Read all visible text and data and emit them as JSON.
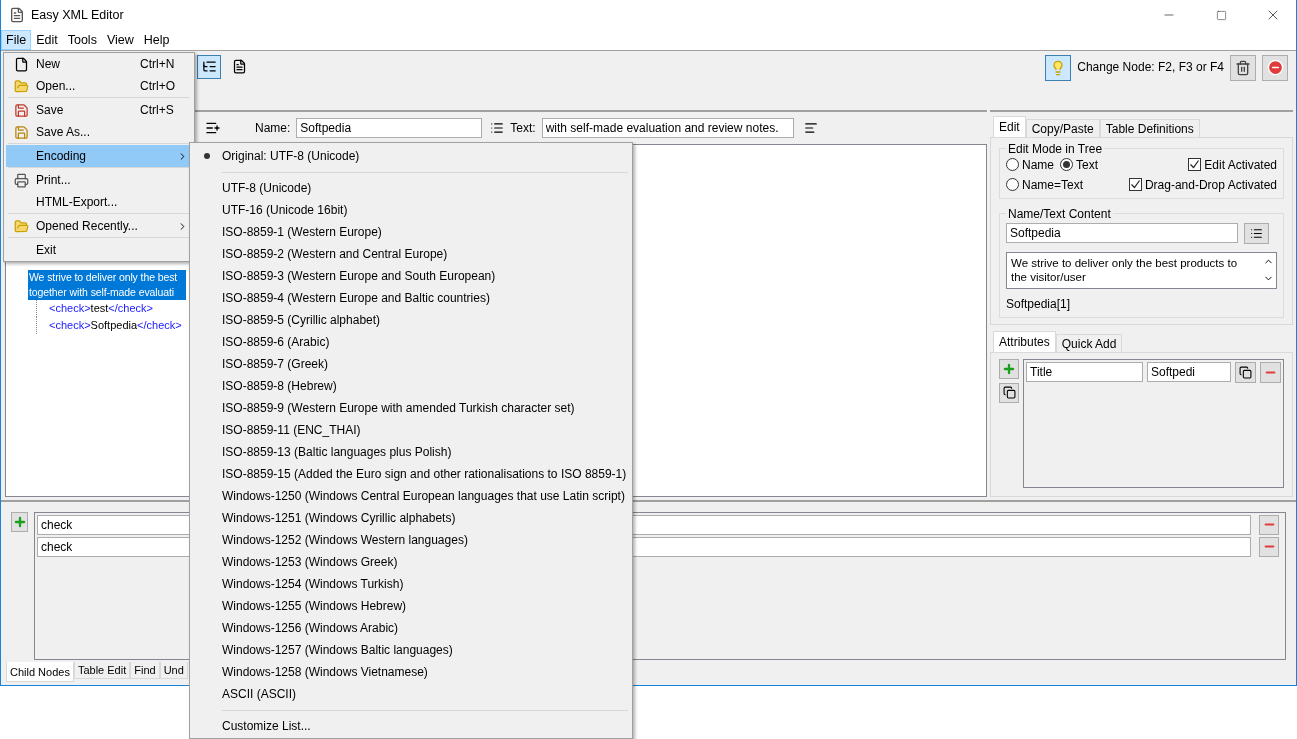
{
  "window": {
    "title": "Easy XML Editor"
  },
  "menu_bar": [
    {
      "label": "File",
      "selected": true
    },
    {
      "label": "Edit",
      "selected": false
    },
    {
      "label": "Tools",
      "selected": false
    },
    {
      "label": "View",
      "selected": false
    },
    {
      "label": "Help",
      "selected": false
    }
  ],
  "toolbar": {
    "view_buttons": [
      {
        "kind": "tree",
        "selected": true
      },
      {
        "kind": "text",
        "selected": false
      }
    ],
    "hint_button": {
      "selected": true
    },
    "hint": "Change Node: F2, F3 or F4"
  },
  "node_bar": {
    "name_label": "Name:",
    "name_value": "Softpedia",
    "text_label": "Text:",
    "text_value": "with self-made evaluation and review notes."
  },
  "tree": [
    {
      "kind": "text",
      "lines": [
        "We strive to deliver only the best",
        "together with self-made evaluati"
      ],
      "selected": true
    },
    {
      "kind": "element",
      "open_tag": "<check>",
      "text": "test",
      "close_tag": "</check>",
      "selected": false
    },
    {
      "kind": "element",
      "open_tag": "<check>",
      "text": "Softpedia",
      "close_tag": "</check>",
      "selected": false
    }
  ],
  "right_tabs": [
    {
      "label": "Edit",
      "selected": true
    },
    {
      "label": "Copy/Paste",
      "selected": false
    },
    {
      "label": "Table Definitions",
      "selected": false
    }
  ],
  "edit_mode": {
    "title": "Edit Mode in Tree",
    "radios": [
      {
        "label": "Name",
        "selected": false
      },
      {
        "label": "Text",
        "selected": true
      },
      {
        "label": "Name=Text",
        "selected": false
      }
    ],
    "checkboxes": [
      {
        "label": "Edit Activated",
        "checked": true
      },
      {
        "label": "Drag-and-Drop Activated",
        "checked": true
      }
    ]
  },
  "content": {
    "title": "Name/Text Content",
    "name_value": "Softpedia",
    "text_value": "We strive to deliver only the best products to the visitor/user",
    "path": "Softpedia[1]"
  },
  "attribute_tabs": [
    {
      "label": "Attributes",
      "selected": true
    },
    {
      "label": "Quick Add",
      "selected": false
    }
  ],
  "attributes": [
    {
      "name": "Title",
      "value": "Softpedi"
    }
  ],
  "child_rows": [
    "check",
    "check"
  ],
  "bottom_tabs": [
    {
      "label": "Child Nodes",
      "selected": true
    },
    {
      "label": "Table Edit",
      "selected": false
    },
    {
      "label": "Find",
      "selected": false
    },
    {
      "label": "Und",
      "selected": false
    }
  ],
  "file_menu": [
    {
      "kind": "new",
      "label": "New",
      "shortcut": "Ctrl+N",
      "selected": false,
      "has_submenu": false
    },
    {
      "kind": "open",
      "label": "Open...",
      "shortcut": "Ctrl+O",
      "selected": false,
      "has_submenu": false
    },
    {
      "kind": "separator"
    },
    {
      "kind": "save",
      "label": "Save",
      "shortcut": "Ctrl+S",
      "selected": false,
      "has_submenu": false
    },
    {
      "kind": "save_as",
      "label": "Save As...",
      "selected": false,
      "has_submenu": false
    },
    {
      "kind": "separator"
    },
    {
      "kind": "plain",
      "label": "Encoding",
      "selected": true,
      "has_submenu": true
    },
    {
      "kind": "separator"
    },
    {
      "kind": "print",
      "label": "Print...",
      "selected": false,
      "has_submenu": false
    },
    {
      "kind": "plain",
      "label": "HTML-Export...",
      "selected": false,
      "has_submenu": false
    },
    {
      "kind": "separator"
    },
    {
      "kind": "open",
      "label": "Opened Recently...",
      "selected": false,
      "has_submenu": true
    },
    {
      "kind": "separator"
    },
    {
      "kind": "plain",
      "label": "Exit",
      "selected": false,
      "has_submenu": false
    }
  ],
  "encoding_menu": {
    "current": {
      "label": "Original: UTF-8 (Unicode)",
      "checked": true
    },
    "options": [
      "UTF-8 (Unicode)",
      "UTF-16 (Unicode 16bit)",
      "ISO-8859-1 (Western Europe)",
      "ISO-8859-2 (Western and Central Europe)",
      "ISO-8859-3 (Western Europe and South European)",
      "ISO-8859-4 (Western Europe and Baltic countries)",
      "ISO-8859-5 (Cyrillic alphabet)",
      "ISO-8859-6 (Arabic)",
      "ISO-8859-7 (Greek)",
      "ISO-8859-8 (Hebrew)",
      "ISO-8859-9 (Western Europe with amended Turkish character set)",
      "ISO-8859-11 (ENC_THAI)",
      "ISO-8859-13 (Baltic languages plus Polish)",
      "ISO-8859-15 (Added the Euro sign and other rationalisations to ISO 8859-1)",
      "Windows-1250 (Windows Central European languages that use Latin script)",
      "Windows-1251 (Windows Cyrillic alphabets)",
      "Windows-1252 (Windows Western languages)",
      "Windows-1253 (Windows Greek)",
      "Windows-1254 (Windows Turkish)",
      "Windows-1255 (Windows Hebrew)",
      "Windows-1256 (Windows Arabic)",
      "Windows-1257 (Windows Baltic languages)",
      "Windows-1258 (Windows Vietnamese)",
      "ASCII (ASCII)"
    ],
    "footer": "Customize List..."
  }
}
